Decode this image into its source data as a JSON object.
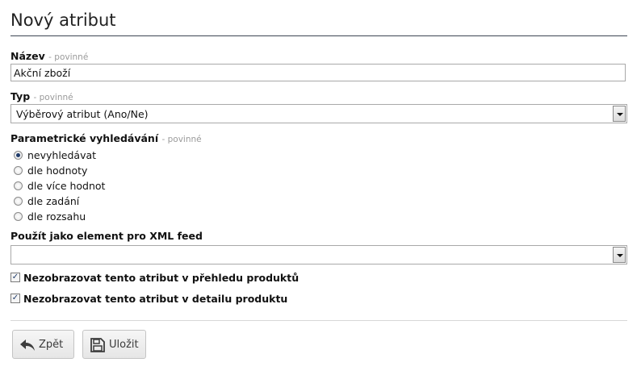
{
  "form": {
    "title": "Nový atribut",
    "name": {
      "label": "Název",
      "required": "- povinné",
      "value": "Akční zboží"
    },
    "type": {
      "label": "Typ",
      "required": "- povinné",
      "selected": "Výběrový atribut (Ano/Ne)"
    },
    "search": {
      "label": "Parametrické vyhledávání",
      "required": "- povinné",
      "options": [
        {
          "label": "nevyhledávat",
          "checked": true
        },
        {
          "label": "dle hodnoty",
          "checked": false
        },
        {
          "label": "dle více hodnot",
          "checked": false
        },
        {
          "label": "dle zadání",
          "checked": false
        },
        {
          "label": "dle rozsahu",
          "checked": false
        }
      ]
    },
    "xml": {
      "label": "Použít jako element pro XML feed",
      "selected": ""
    },
    "checkboxes": [
      {
        "label": "Nezobrazovat tento atribut v přehledu produktů",
        "checked": true
      },
      {
        "label": "Nezobrazovat tento atribut v detailu produktu",
        "checked": true
      }
    ],
    "buttons": {
      "back": "Zpět",
      "save": "Uložit"
    }
  },
  "icons": {
    "back": "undo-arrow-icon",
    "save": "floppy-disk-icon"
  },
  "colors": {
    "title_rule": "#3c4654",
    "required_text": "#9a9a9a",
    "check_mark": "#1f3b6b"
  }
}
